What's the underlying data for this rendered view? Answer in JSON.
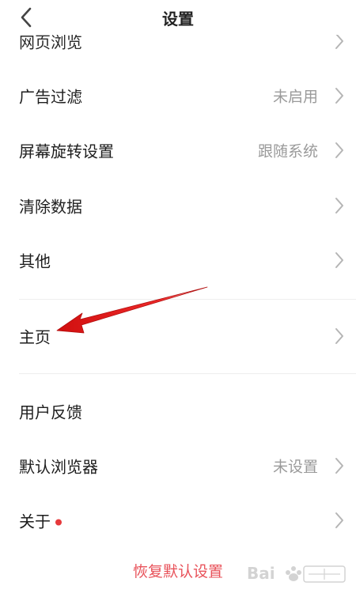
{
  "header": {
    "title": "设置"
  },
  "rows": [
    {
      "label": "网页浏览"
    },
    {
      "label": "广告过滤",
      "value": "未启用"
    },
    {
      "label": "屏幕旋转设置",
      "value": "跟随系统"
    },
    {
      "label": "清除数据"
    },
    {
      "label": "其他"
    },
    {
      "label": "主页"
    },
    {
      "label": "用户反馈"
    },
    {
      "label": "默认浏览器",
      "value": "未设置"
    },
    {
      "label": "关于"
    }
  ],
  "restore_label": "恢复默认设置",
  "colors": {
    "accent_red": "#e8525a",
    "badge_red": "#e6393b",
    "secondary_text": "#9a9a9a",
    "arrow_red": "#e21b1b"
  },
  "icons": {
    "back": "chevron-left-icon",
    "row_arrow": "chevron-right-icon",
    "annotation": "red-arrow-annotation",
    "watermark": "baidu-jingyan-watermark"
  }
}
